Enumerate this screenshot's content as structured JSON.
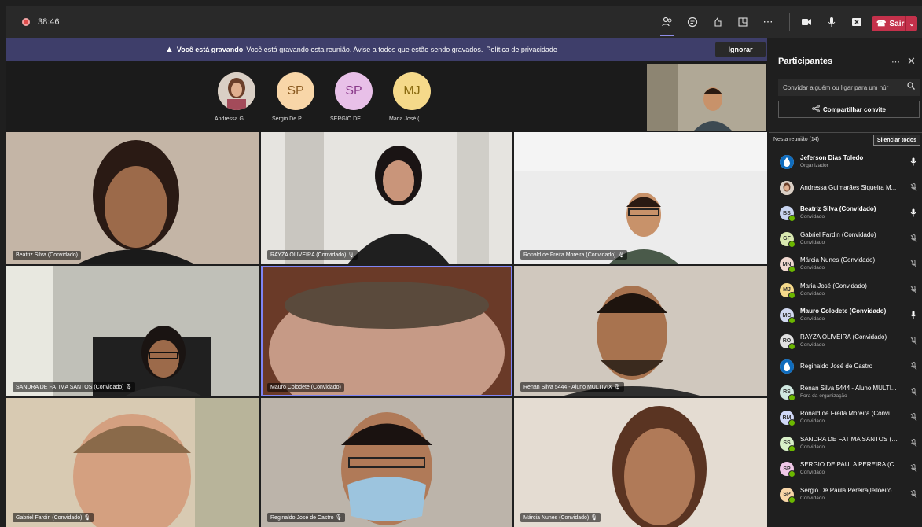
{
  "topbar": {
    "timer": "38:46",
    "leave_label": "Sair"
  },
  "banner": {
    "title": "Você está gravando",
    "message": "Você está gravando esta reunião. Avise a todos que estão sendo gravados.",
    "link": "Política de privacidade",
    "ignore_label": "Ignorar"
  },
  "avatars": [
    {
      "initials": "",
      "label": "Andressa G...",
      "color": "#d9c7b8"
    },
    {
      "initials": "SP",
      "label": "Sergio De P...",
      "color": "#f8d6a8"
    },
    {
      "initials": "SP",
      "label": "SERGIO DE ...",
      "color": "#e8c0e8"
    },
    {
      "initials": "MJ",
      "label": "Maria José (...",
      "color": "#f5d98a"
    }
  ],
  "tiles": [
    {
      "name": "Beatriz Silva (Convidado)"
    },
    {
      "name": "RAYZA OLIVEIRA (Convidado) 🎙"
    },
    {
      "name": "Ronald de Freita Moreira (Convidado) 🎙"
    },
    {
      "name": "SANDRA DE FATIMA SANTOS (Convidado) 🎙"
    },
    {
      "name": "Mauro Colodete (Convidado)"
    },
    {
      "name": "Renan Silva 5444 - Aluno MULTIVIX 🎙"
    },
    {
      "name": "Gabriel Fardin (Convidado) 🎙"
    },
    {
      "name": "Reginaldo José de Castro 🎙"
    },
    {
      "name": "Márcia Nunes (Convidado) 🎙"
    }
  ],
  "panel": {
    "title": "Participantes",
    "search_placeholder": "Convidar alguém ou ligar para um núr",
    "share_label": "Compartilhar convite",
    "section_label": "Nesta reunião (14)",
    "mute_all_label": "Silenciar todos",
    "participants": [
      {
        "initials": "",
        "name": "Jeferson Dias Toledo",
        "role": "Organizador",
        "color": "#ffffff",
        "mic_on": true
      },
      {
        "initials": "",
        "name": "Andressa Guimarães Siqueira M...",
        "role": "",
        "color": "#c9a08a",
        "mic_on": false
      },
      {
        "initials": "BS",
        "name": "Beatriz Silva (Convidado)",
        "role": "Convidado",
        "color": "#c8d4f0",
        "mic_on": true
      },
      {
        "initials": "GF",
        "name": "Gabriel Fardin (Convidado)",
        "role": "Convidado",
        "color": "#d8e8b0",
        "mic_on": false
      },
      {
        "initials": "MN",
        "name": "Márcia Nunes (Convidado)",
        "role": "Convidado",
        "color": "#f0d8d0",
        "mic_on": false
      },
      {
        "initials": "MJ",
        "name": "Maria José (Convidado)",
        "role": "Convidado",
        "color": "#f5d98a",
        "mic_on": false
      },
      {
        "initials": "MC",
        "name": "Mauro Colodete (Convidado)",
        "role": "Convidado",
        "color": "#d0d8f0",
        "mic_on": true
      },
      {
        "initials": "RO",
        "name": "RAYZA OLIVEIRA (Convidado)",
        "role": "Convidado",
        "color": "#e0e0e0",
        "mic_on": false
      },
      {
        "initials": "",
        "name": "Reginaldo José de Castro",
        "role": "",
        "color": "#ffffff",
        "mic_on": false
      },
      {
        "initials": "RS",
        "name": "Renan Silva 5444 - Aluno MULTI...",
        "role": "Fora da organização",
        "color": "#d0e8e0",
        "mic_on": false
      },
      {
        "initials": "RM",
        "name": "Ronald de Freita Moreira (Convi...",
        "role": "Convidado",
        "color": "#d0d8f8",
        "mic_on": false
      },
      {
        "initials": "SS",
        "name": "SANDRA DE FATIMA SANTOS (C...",
        "role": "Convidado",
        "color": "#d8f0c8",
        "mic_on": false
      },
      {
        "initials": "SP",
        "name": "SERGIO DE PAULA PEREIRA (Con...",
        "role": "Convidado",
        "color": "#f0c8e8",
        "mic_on": false
      },
      {
        "initials": "SP",
        "name": "Sergio De Paula Pereira(leiloeiro...",
        "role": "Convidado",
        "color": "#f8d6a8",
        "mic_on": false
      }
    ]
  }
}
